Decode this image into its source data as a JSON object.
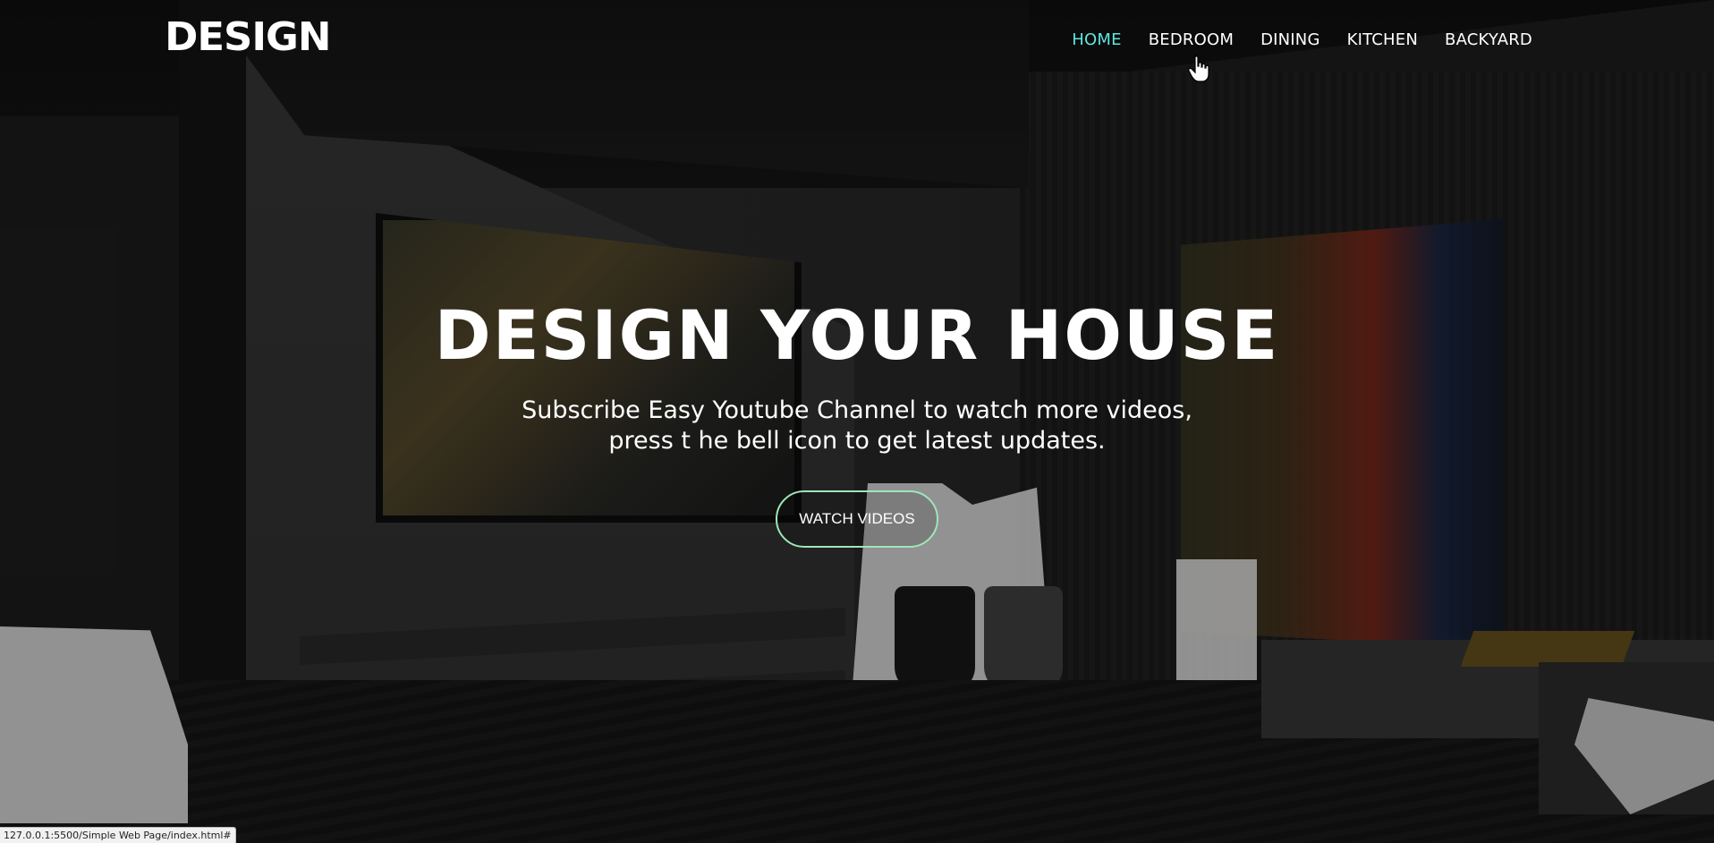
{
  "logo": {
    "text": "DESIGN"
  },
  "nav": {
    "items": [
      {
        "label": "HOME",
        "active": true
      },
      {
        "label": "BEDROOM",
        "active": false
      },
      {
        "label": "DINING",
        "active": false
      },
      {
        "label": "KITCHEN",
        "active": false
      },
      {
        "label": "BACKYARD",
        "active": false
      }
    ],
    "active_color": "#5ee6df"
  },
  "hero": {
    "title": "DESIGN YOUR HOUSE",
    "subtitle_line1": "Subscribe Easy Youtube Channel to watch more videos,",
    "subtitle_line2": "press t he bell icon to get latest updates.",
    "cta_label": "WATCH VIDEOS",
    "cta_border_color": "#9fe6b8"
  },
  "cursor": {
    "icon": "hand-pointer-icon"
  },
  "status_bar": {
    "url": "127.0.0.1:5500/Simple Web Page/index.html#"
  }
}
